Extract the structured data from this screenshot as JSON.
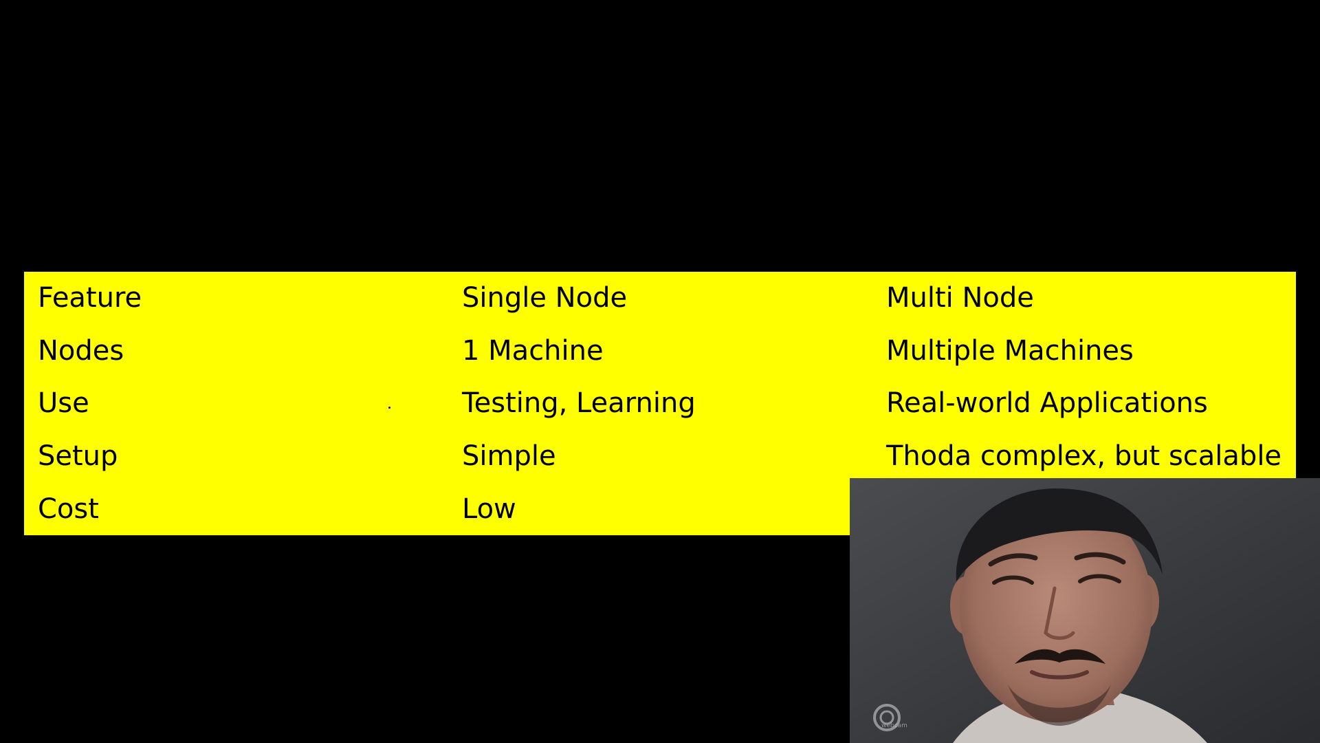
{
  "table": {
    "rows": [
      [
        "Feature",
        "Single Node",
        "Multi Node"
      ],
      [
        "Nodes",
        "1 Machine",
        "Multiple Machines"
      ],
      [
        "Use",
        "Testing, Learning",
        "Real-world Applications"
      ],
      [
        "Setup",
        "Simple",
        "Thoda complex, but scalable"
      ],
      [
        "Cost",
        "Low",
        ""
      ]
    ]
  },
  "webcam": {
    "brand_label": "webcam"
  },
  "colors": {
    "background": "#000000",
    "table_fill": "#ffff00",
    "text": "#000000"
  }
}
